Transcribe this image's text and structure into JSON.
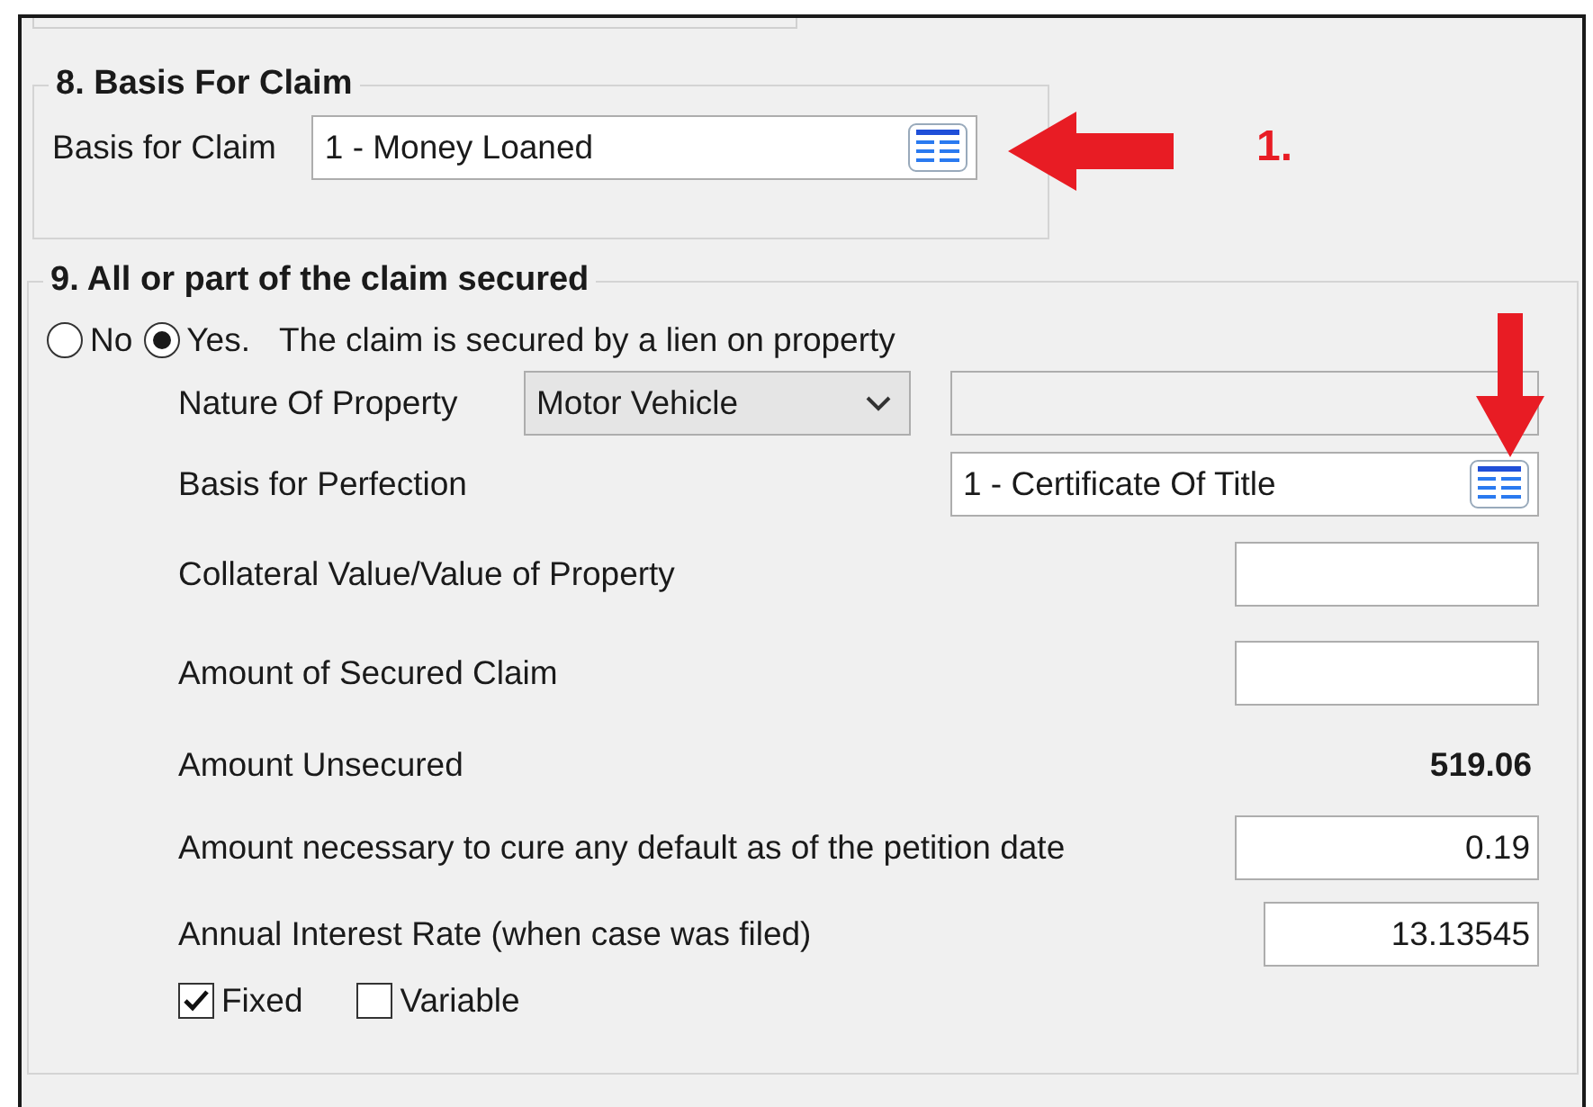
{
  "section_8": {
    "title": "8.  Basis For Claim",
    "label": "Basis for Claim",
    "value": "1 - Money Loaned"
  },
  "section_9": {
    "title": "9.  All or part of the claim secured",
    "secured_options": [
      {
        "label": "No",
        "selected": false
      },
      {
        "label": "Yes.",
        "selected": true
      }
    ],
    "secured_description": "The claim is secured by a lien on property",
    "rows": [
      {
        "kind": "combo",
        "label": "Nature Of Property",
        "value": "Motor Vehicle"
      },
      {
        "kind": "lookup",
        "label": "Basis for Perfection",
        "value": "1 - Certificate Of Title"
      },
      {
        "kind": "input",
        "label": "Collateral Value/Value of Property"
      },
      {
        "kind": "input",
        "label": "Amount of Secured Claim"
      },
      {
        "kind": "total",
        "label": "Amount Unsecured",
        "value": "519.06"
      },
      {
        "kind": "input",
        "label": "Amount necessary to cure any default as of the petition date",
        "value": "0.19"
      },
      {
        "kind": "input",
        "label": "Annual Interest Rate (when case was filed)",
        "value": "13.13545"
      }
    ],
    "rate_types": [
      {
        "label": "Fixed",
        "checked": true
      },
      {
        "label": "Variable",
        "checked": false
      }
    ]
  },
  "annotations": [
    {
      "kind": "arrow-left"
    },
    {
      "kind": "step-label",
      "text": "1."
    },
    {
      "kind": "arrow-down"
    }
  ]
}
